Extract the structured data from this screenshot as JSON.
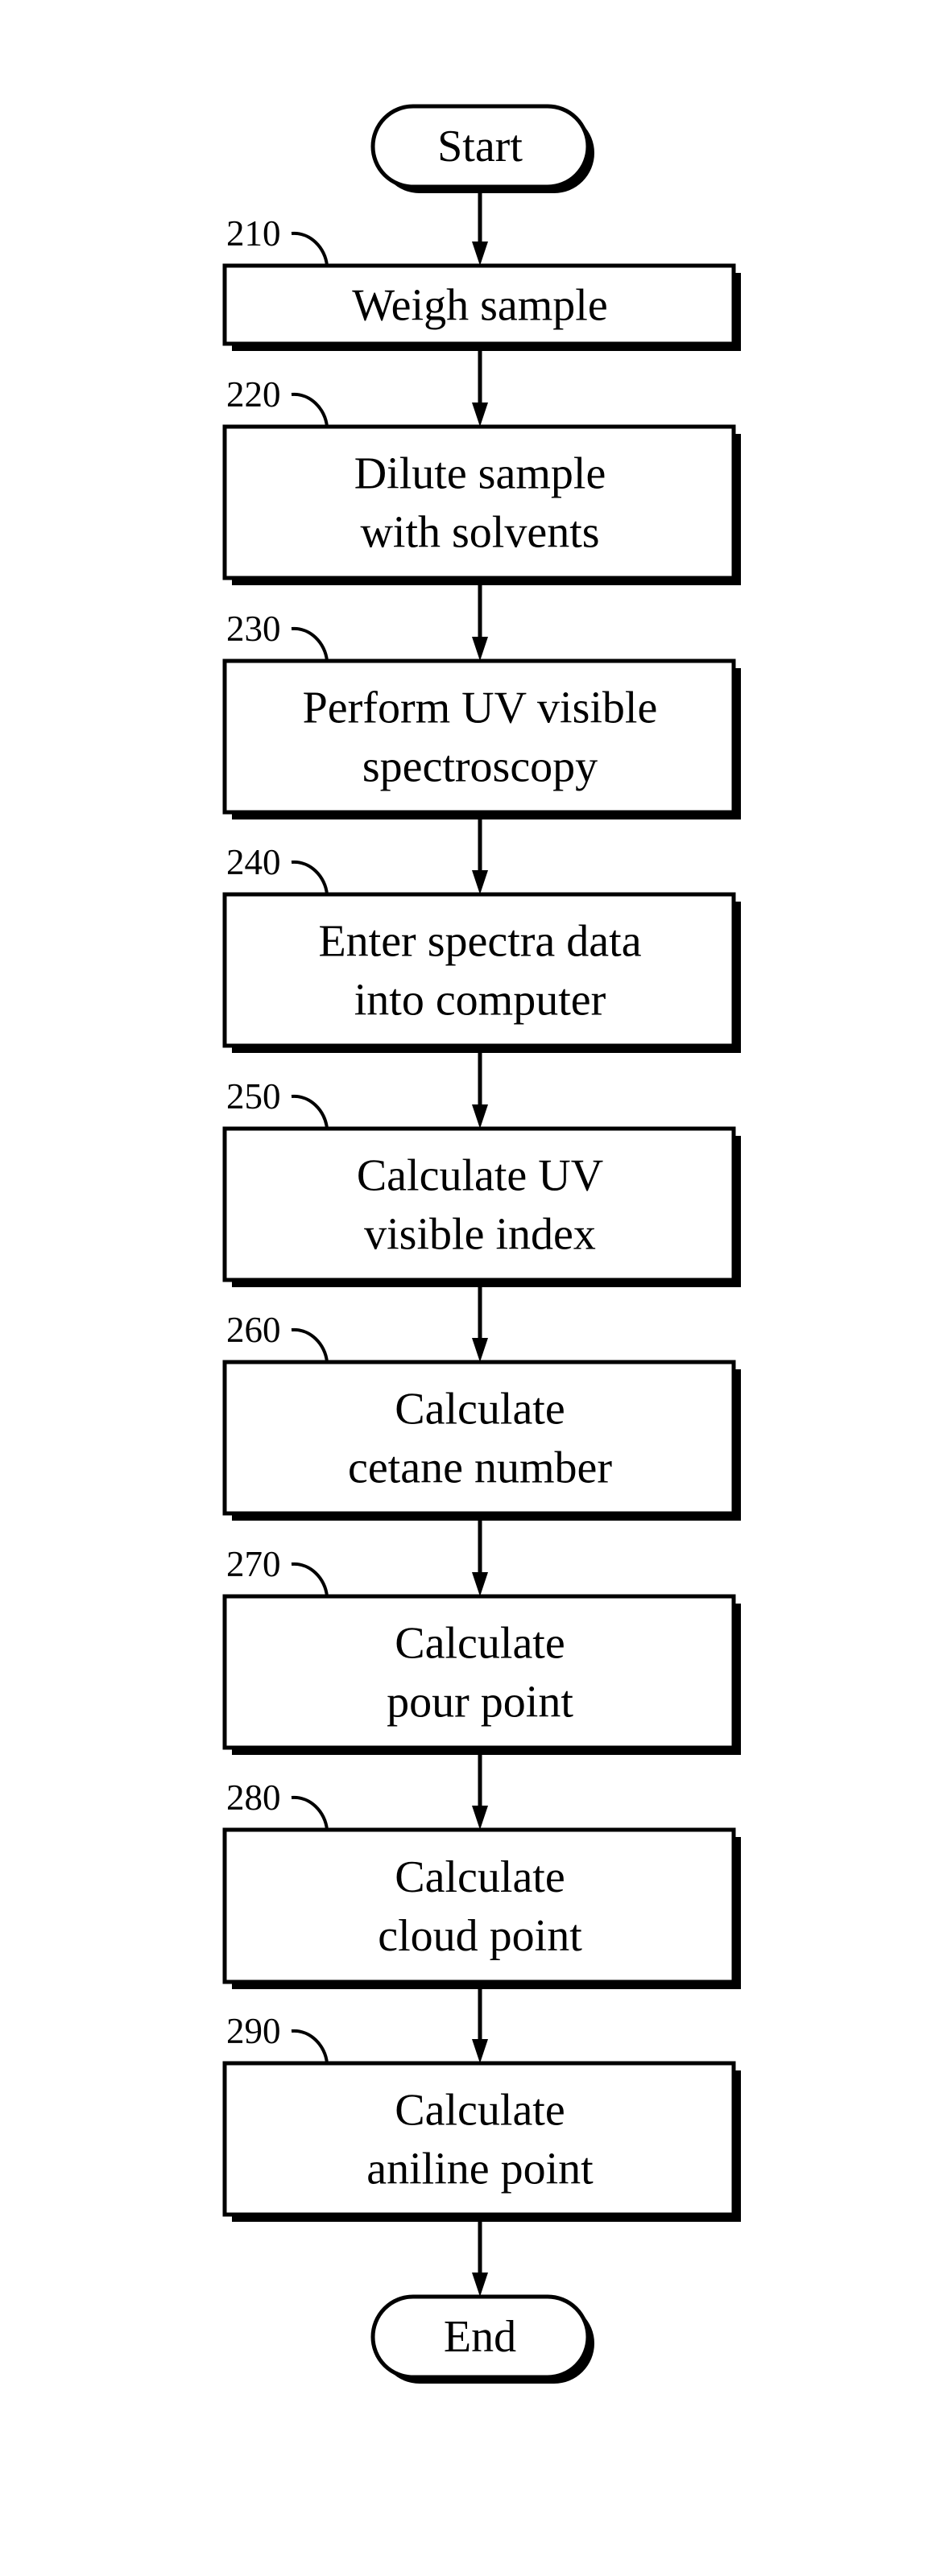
{
  "diagram": {
    "type": "flowchart",
    "start": {
      "label": "Start"
    },
    "end": {
      "label": "End"
    },
    "steps": [
      {
        "ref": "210",
        "lines": [
          "Weigh sample"
        ]
      },
      {
        "ref": "220",
        "lines": [
          "Dilute sample",
          "with solvents"
        ]
      },
      {
        "ref": "230",
        "lines": [
          "Perform UV visible",
          "spectroscopy"
        ]
      },
      {
        "ref": "240",
        "lines": [
          "Enter spectra data",
          "into computer"
        ]
      },
      {
        "ref": "250",
        "lines": [
          "Calculate UV",
          "visible index"
        ]
      },
      {
        "ref": "260",
        "lines": [
          "Calculate",
          "cetane number"
        ]
      },
      {
        "ref": "270",
        "lines": [
          "Calculate",
          "pour point"
        ]
      },
      {
        "ref": "280",
        "lines": [
          "Calculate",
          "cloud point"
        ]
      },
      {
        "ref": "290",
        "lines": [
          "Calculate",
          "aniline point"
        ]
      }
    ],
    "colors": {
      "stroke": "#000000",
      "fill": "#ffffff"
    }
  }
}
